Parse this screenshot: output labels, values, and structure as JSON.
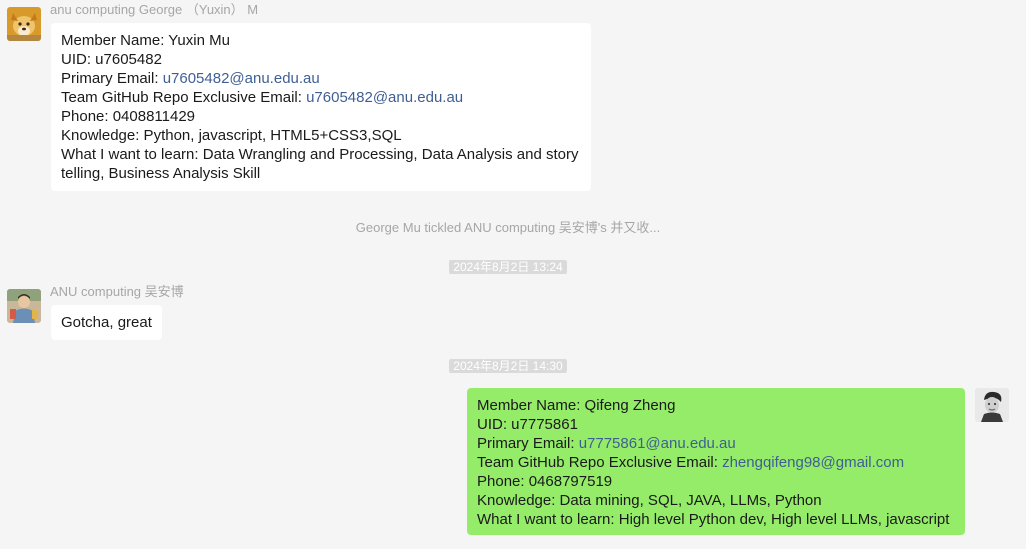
{
  "messages": {
    "m1": {
      "sender": "anu computing George （Yuxin） M",
      "lines": {
        "name": "Member Name: Yuxin Mu",
        "uid": "UID: u7605482",
        "primary_prefix": "Primary Email: ",
        "primary_email": "u7605482@anu.edu.au",
        "github_prefix": "Team GitHub Repo Exclusive Email: ",
        "github_email": "u7605482@anu.edu.au",
        "phone": "Phone: 0408811429",
        "knowledge": "Knowledge: Python, javascript, HTML5+CSS3,SQL",
        "learn": "What I want to learn: Data Wrangling and Processing, Data Analysis and story telling, Business Analysis Skill"
      }
    },
    "system_tickle": "George Mu tickled ANU computing 吴安博's 并又收...",
    "time1": "2024年8月2日 13:24",
    "m2": {
      "sender": "ANU computing 吴安博",
      "text": "Gotcha, great"
    },
    "time2": "2024年8月2日 14:30",
    "m3": {
      "lines": {
        "name": "Member Name: Qifeng Zheng",
        "uid": "UID: u7775861",
        "primary_prefix": "Primary Email: ",
        "primary_email": "u7775861@anu.edu.au",
        "github_prefix": "Team GitHub Repo Exclusive Email: ",
        "github_email": "zhengqifeng98@gmail.com",
        "phone": "Phone: 0468797519",
        "knowledge": "Knowledge: Data mining, SQL, JAVA, LLMs, Python",
        "learn": "What I want to learn: High level Python dev,  High level LLMs, javascript"
      }
    }
  },
  "colors": {
    "background": "#f5f5f5",
    "bubble_self": "#95ec69",
    "bubble_other": "#ffffff",
    "link": "#3f5f94"
  },
  "icons": {
    "avatar1": "shiba-dog-avatar",
    "avatar2": "person-photo-avatar",
    "avatar3": "self-portrait-avatar"
  }
}
